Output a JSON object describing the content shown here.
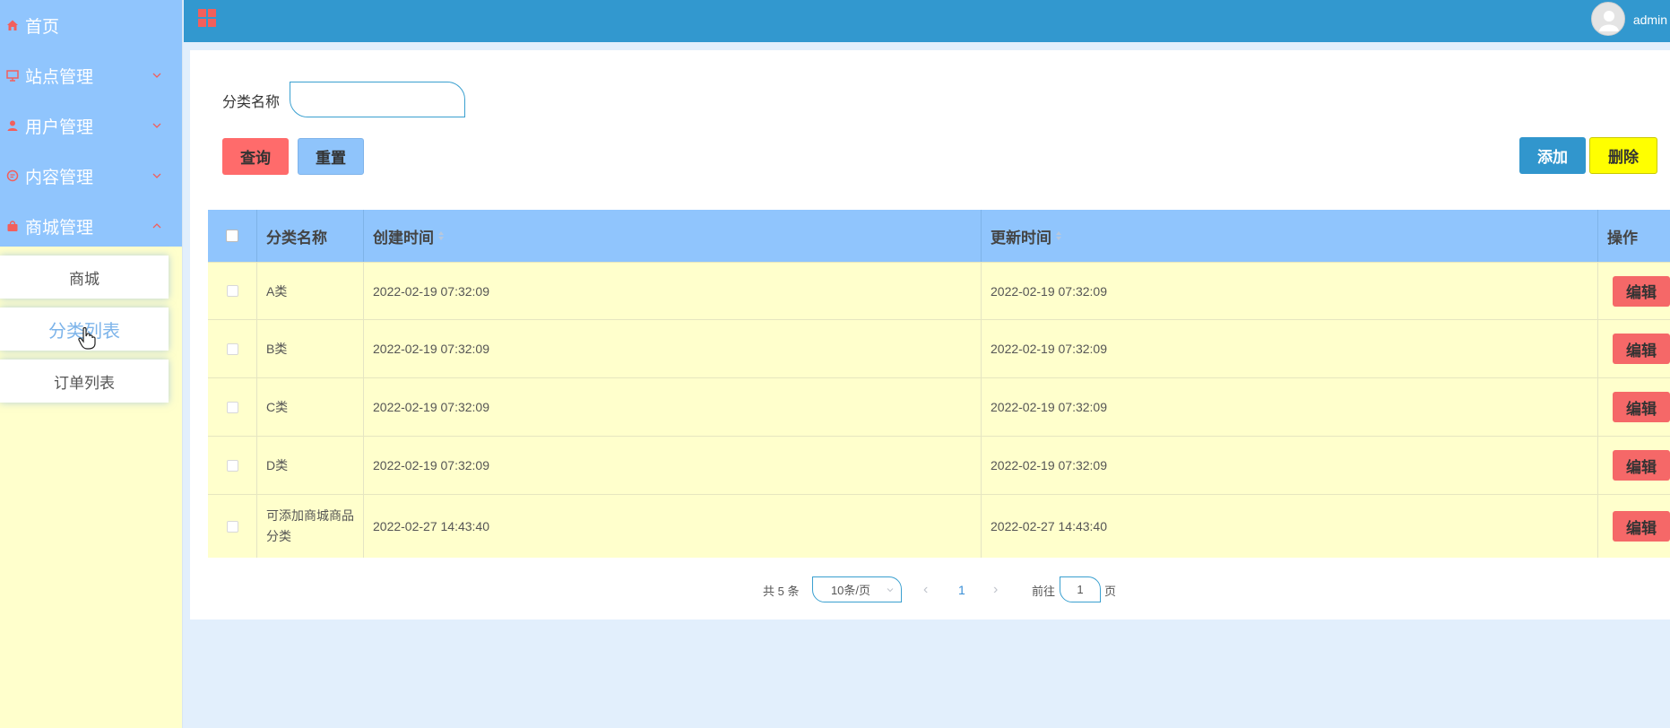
{
  "sidebar": {
    "items": [
      {
        "label": "首页",
        "icon": "home-icon"
      },
      {
        "label": "站点管理",
        "icon": "monitor-icon"
      },
      {
        "label": "用户管理",
        "icon": "user-icon"
      },
      {
        "label": "内容管理",
        "icon": "message-icon"
      },
      {
        "label": "商城管理",
        "icon": "bag-icon"
      }
    ],
    "submenu": [
      {
        "label": "商城"
      },
      {
        "label": "分类列表"
      },
      {
        "label": "订单列表"
      }
    ]
  },
  "header": {
    "username": "admin"
  },
  "search": {
    "label": "分类名称",
    "value": "",
    "placeholder": ""
  },
  "buttons": {
    "query": "查询",
    "reset": "重置",
    "add": "添加",
    "delete": "删除"
  },
  "table": {
    "columns": {
      "name": "分类名称",
      "created": "创建时间",
      "updated": "更新时间",
      "op": "操作"
    },
    "edit_label": "编辑",
    "rows": [
      {
        "name": "A类",
        "created": "2022-02-19 07:32:09",
        "updated": "2022-02-19 07:32:09"
      },
      {
        "name": "B类",
        "created": "2022-02-19 07:32:09",
        "updated": "2022-02-19 07:32:09"
      },
      {
        "name": "C类",
        "created": "2022-02-19 07:32:09",
        "updated": "2022-02-19 07:32:09"
      },
      {
        "name": "D类",
        "created": "2022-02-19 07:32:09",
        "updated": "2022-02-19 07:32:09"
      },
      {
        "name": "可添加商城商品分类",
        "created": "2022-02-27 14:43:40",
        "updated": "2022-02-27 14:43:40"
      }
    ]
  },
  "pagination": {
    "total": "共 5 条",
    "page_size": "10条/页",
    "current": "1",
    "goto_label": "前往",
    "goto_value": "1",
    "page_suffix": "页"
  },
  "colors": {
    "header": "#3298cf",
    "sidebar_top": "#90c5fd",
    "row_bg": "#ffffcc",
    "accent_red": "#ff6b6b",
    "icon_red": "#f25f5c"
  }
}
